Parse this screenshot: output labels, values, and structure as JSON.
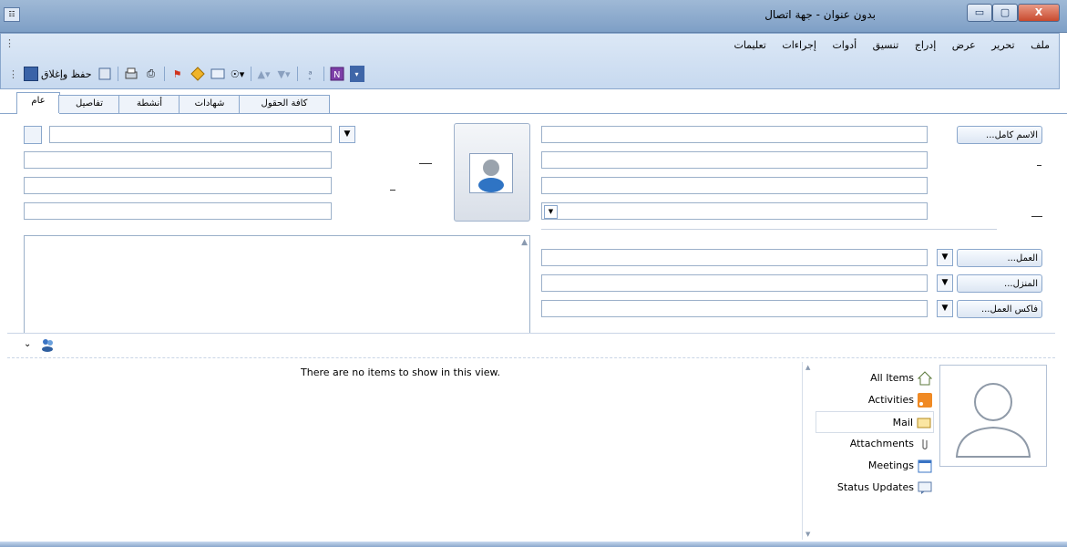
{
  "window": {
    "title": "بدون عنوان - جهة اتصال",
    "minimize_label": "▭",
    "maximize_label": "▢",
    "close_label": "X"
  },
  "menu": [
    "ملف",
    "تحرير",
    "عرض",
    "إدراج",
    "تنسيق",
    "أدوات",
    "إجراءات",
    "تعليمات"
  ],
  "toolbar": {
    "save_close_label": "حفظ وإغلاق",
    "icons": [
      "save-icon",
      "new-icon",
      "print-icon",
      "attach-icon",
      "flag-icon",
      "categorize-icon",
      "business-card-icon",
      "dropdown-icon",
      "up-arrow-icon",
      "down-arrow-icon",
      "spelling-icon",
      "onenote-icon"
    ]
  },
  "tabs": [
    "عام",
    "تفاصيل",
    "أنشطة",
    "شهادات",
    "كافة الحقول"
  ],
  "active_tab": "عام",
  "form": {
    "full_name_label": "الاسم كامل...",
    "business_label": "العمل...",
    "home_label": "المنزل...",
    "business_fax_label": "فاكس العمل..."
  },
  "people_pane": {
    "empty_message": "There are no items to show in this view.",
    "nav_items": [
      {
        "label": "All Items",
        "icon": "home-icon"
      },
      {
        "label": "Activities",
        "icon": "rss-icon"
      },
      {
        "label": "Mail",
        "icon": "mail-icon"
      },
      {
        "label": "Attachments",
        "icon": "paperclip-icon"
      },
      {
        "label": "Meetings",
        "icon": "calendar-icon"
      },
      {
        "label": "Status Updates",
        "icon": "status-icon"
      }
    ],
    "selected_item": "Mail"
  },
  "colors": {
    "titlebar": "#8fabd0",
    "toolbar": "#d3e2f4",
    "border": "#8aa7cc"
  }
}
